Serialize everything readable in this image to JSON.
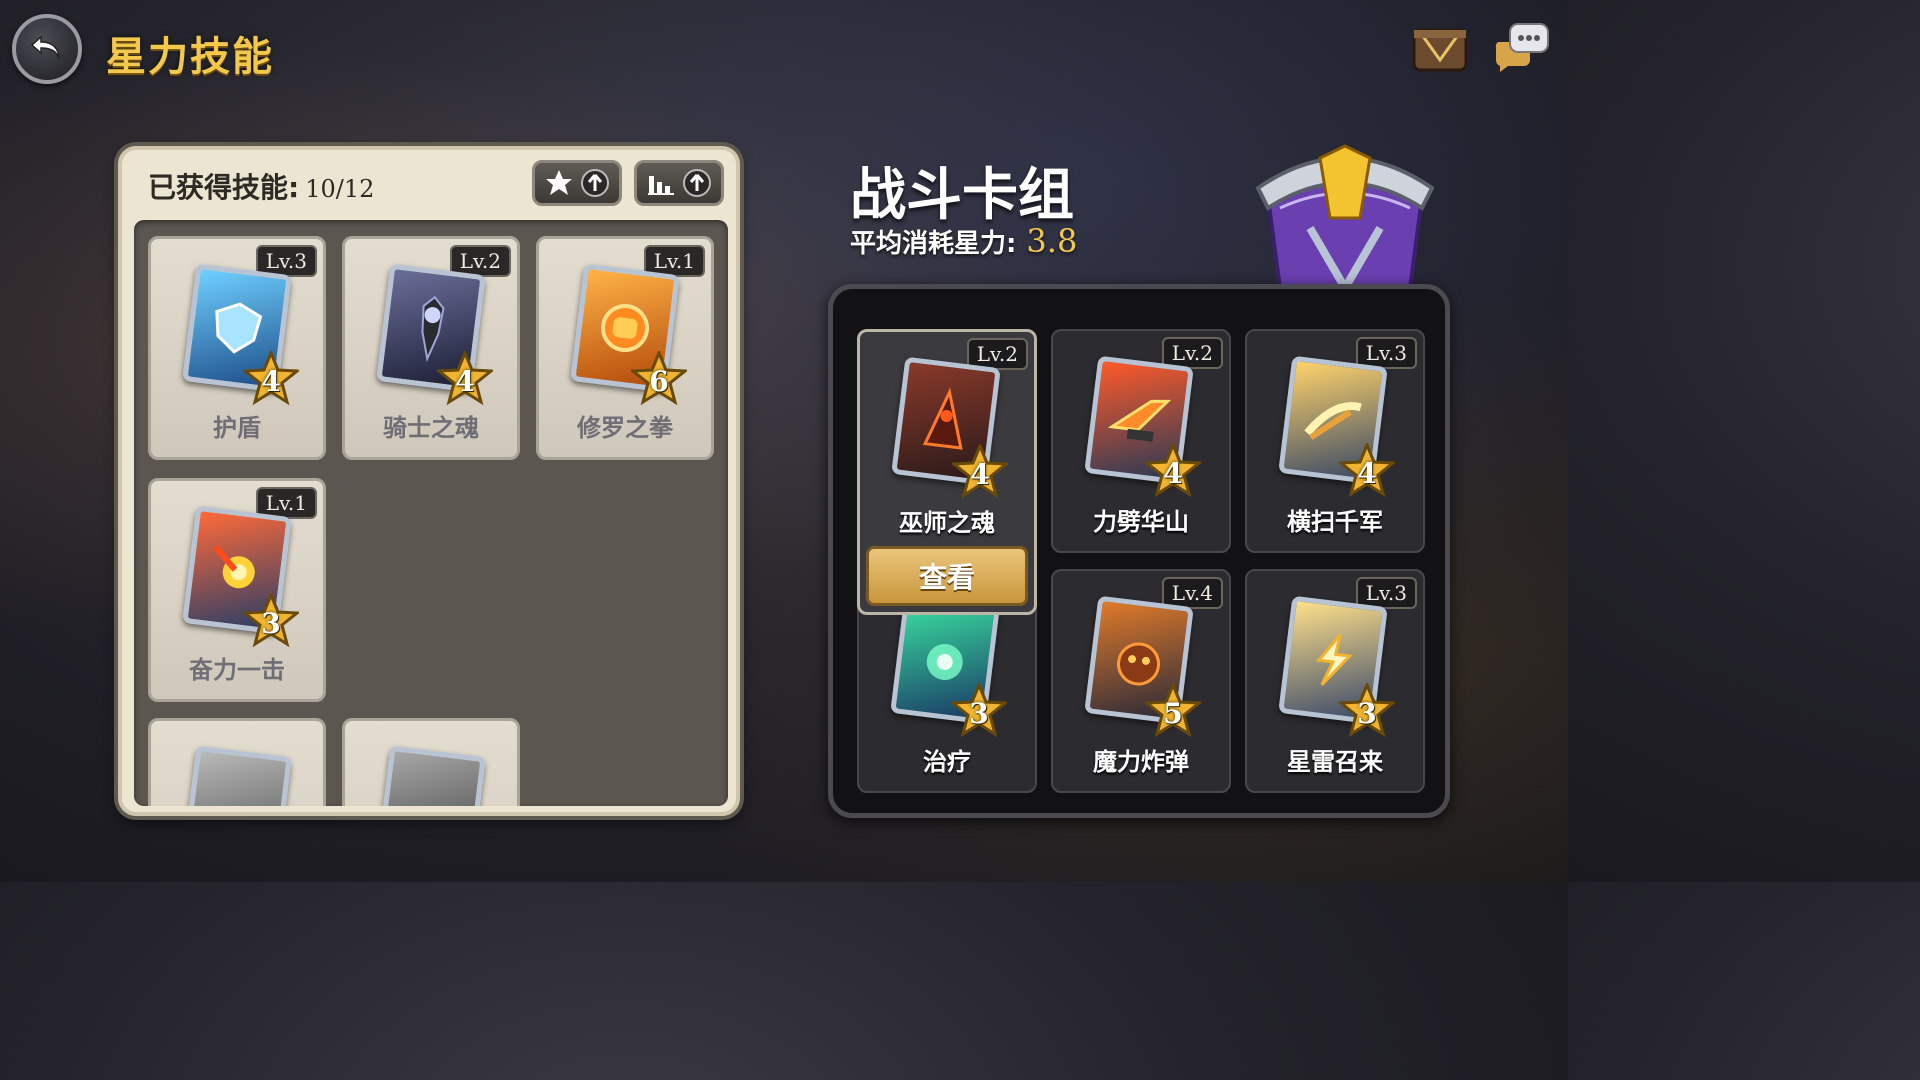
{
  "header": {
    "title": "星力技能"
  },
  "left": {
    "acquired_label": "已获得技能:",
    "acquired_count": "10/12",
    "skills": [
      {
        "name": "护盾",
        "level": "Lv.3",
        "cost": "4",
        "icon": "shield-card-icon"
      },
      {
        "name": "骑士之魂",
        "level": "Lv.2",
        "cost": "4",
        "icon": "knight-card-icon"
      },
      {
        "name": "修罗之拳",
        "level": "Lv.1",
        "cost": "6",
        "icon": "fist-card-icon"
      },
      {
        "name": "奋力一击",
        "level": "Lv.1",
        "cost": "3",
        "icon": "strike-card-icon"
      }
    ]
  },
  "deck": {
    "title": "战斗卡组",
    "avg_label": "平均消耗星力:",
    "avg_value": "3.8",
    "view_label": "查看",
    "cards": [
      {
        "name": "巫师之魂",
        "level": "Lv.2",
        "cost": "4",
        "icon": "wizard-card-icon"
      },
      {
        "name": "力劈华山",
        "level": "Lv.2",
        "cost": "4",
        "icon": "cleave-card-icon"
      },
      {
        "name": "横扫千军",
        "level": "Lv.3",
        "cost": "4",
        "icon": "sweep-card-icon"
      },
      {
        "name": "治疗",
        "level": "",
        "cost": "3",
        "icon": "heal-card-icon"
      },
      {
        "name": "魔力炸弹",
        "level": "Lv.4",
        "cost": "5",
        "icon": "bomb-card-icon"
      },
      {
        "name": "星雷召来",
        "level": "Lv.3",
        "cost": "3",
        "icon": "thunder-card-icon"
      }
    ]
  },
  "colors": {
    "accent_gold": "#f2c94c",
    "panel_cream": "#ece5d2",
    "deck_dark": "#121214"
  }
}
